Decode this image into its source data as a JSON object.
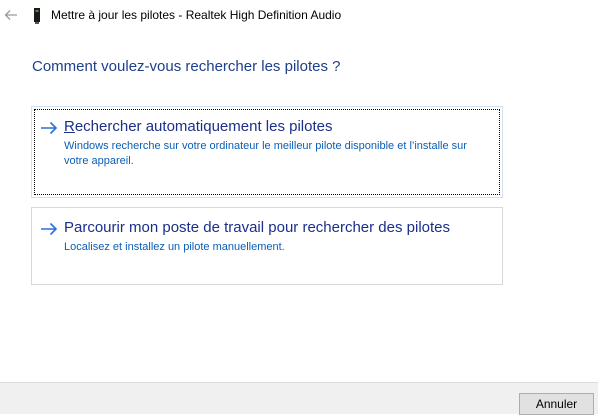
{
  "window": {
    "title": "Mettre à jour les pilotes - Realtek High Definition Audio"
  },
  "heading": "Comment voulez-vous rechercher les pilotes ?",
  "options": [
    {
      "accelerator": "R",
      "title_rest": "echercher automatiquement les pilotes",
      "description": "Windows recherche sur votre ordinateur le meilleur pilote disponible et l’installe sur votre appareil.",
      "icon": "arrow-right-icon"
    },
    {
      "title": "Parcourir mon poste de travail pour rechercher des pilotes",
      "description": "Localisez et installez un pilote manuellement.",
      "icon": "arrow-right-icon"
    }
  ],
  "footer": {
    "cancel_label": "Annuler"
  },
  "colors": {
    "heading": "#1e3f8a",
    "link": "#1a2f8a",
    "description": "#0b5fb5",
    "arrow": "#2e6fd6"
  }
}
